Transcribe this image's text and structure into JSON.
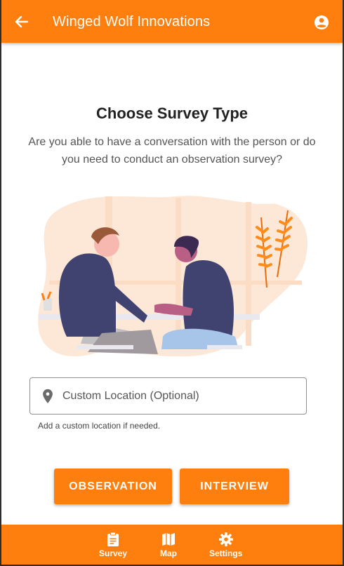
{
  "appbar": {
    "title": "Winged Wolf Innovations",
    "back_icon": "arrow-left-icon",
    "account_icon": "account-circle-icon"
  },
  "content": {
    "heading": "Choose Survey Type",
    "description": "Are you able to have a conversation with the person or do you need to conduct an observation survey?",
    "location_placeholder": "Custom Location (Optional)",
    "location_helper": "Add a custom location if needed.",
    "location_icon": "map-pin-icon"
  },
  "buttons": {
    "observation": "OBSERVATION",
    "interview": "INTERVIEW"
  },
  "bottom_nav": [
    {
      "label": "Survey",
      "icon": "clipboard-icon"
    },
    {
      "label": "Map",
      "icon": "map-icon"
    },
    {
      "label": "Settings",
      "icon": "gear-icon"
    }
  ],
  "colors": {
    "accent": "#ff7f0e",
    "text": "#222222"
  }
}
